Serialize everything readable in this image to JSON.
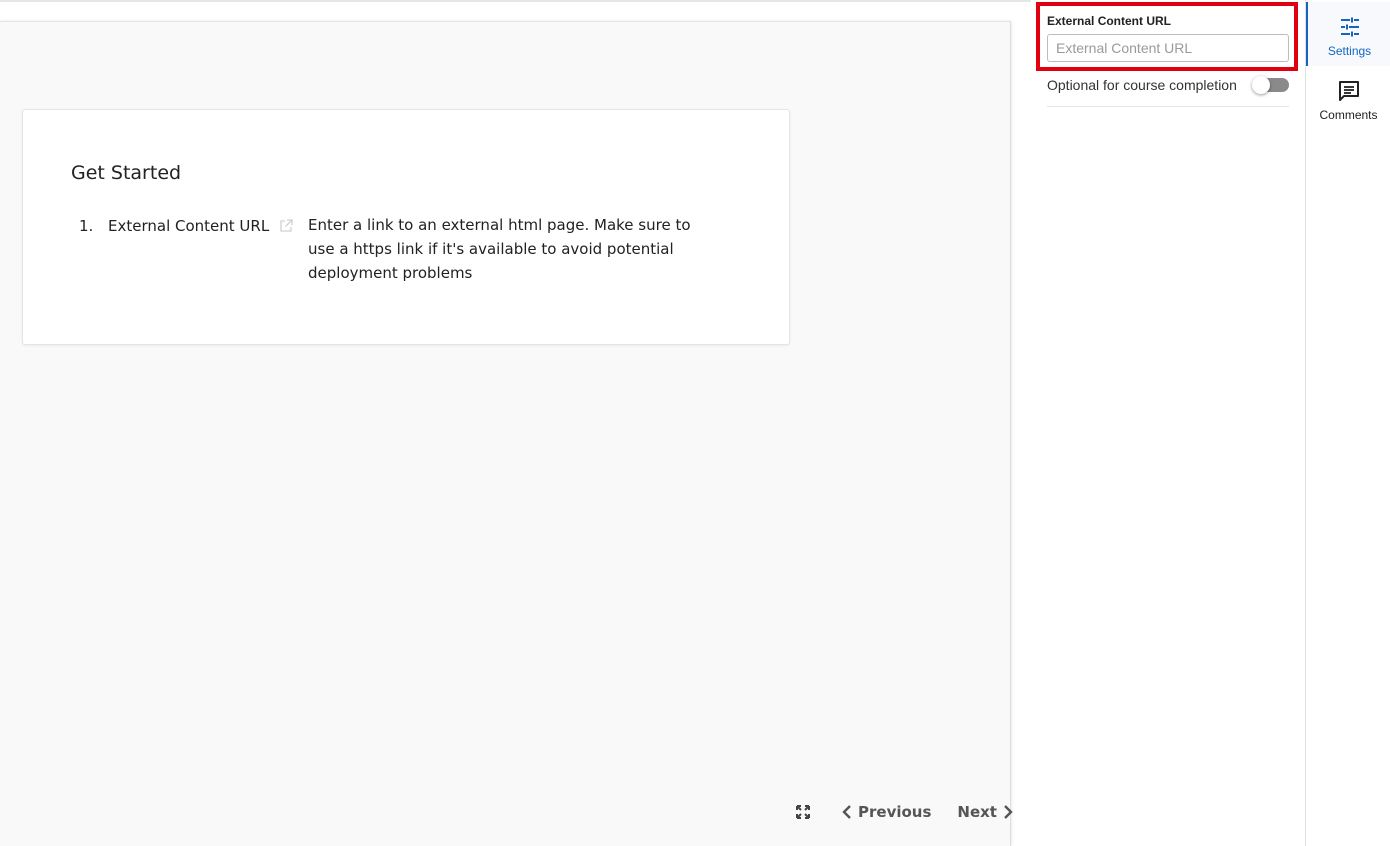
{
  "main": {
    "card": {
      "title": "Get Started",
      "steps": [
        {
          "number": "1.",
          "name": "External Content URL",
          "description": "Enter a link to an external html page. Make sure to use a https link if it's available to avoid potential deployment problems"
        }
      ]
    },
    "footer": {
      "previous_label": "Previous",
      "next_label": "Next"
    }
  },
  "settings": {
    "url_field": {
      "label": "External Content URL",
      "placeholder": "External Content URL",
      "value": ""
    },
    "optional_completion": {
      "label": "Optional for course completion",
      "enabled": false
    },
    "highlight_color": "#e0000f"
  },
  "rail": {
    "items": [
      {
        "label": "Settings",
        "icon": "sliders-icon",
        "active": true
      },
      {
        "label": "Comments",
        "icon": "comment-icon",
        "active": false
      }
    ],
    "accent": "#1565c0"
  }
}
